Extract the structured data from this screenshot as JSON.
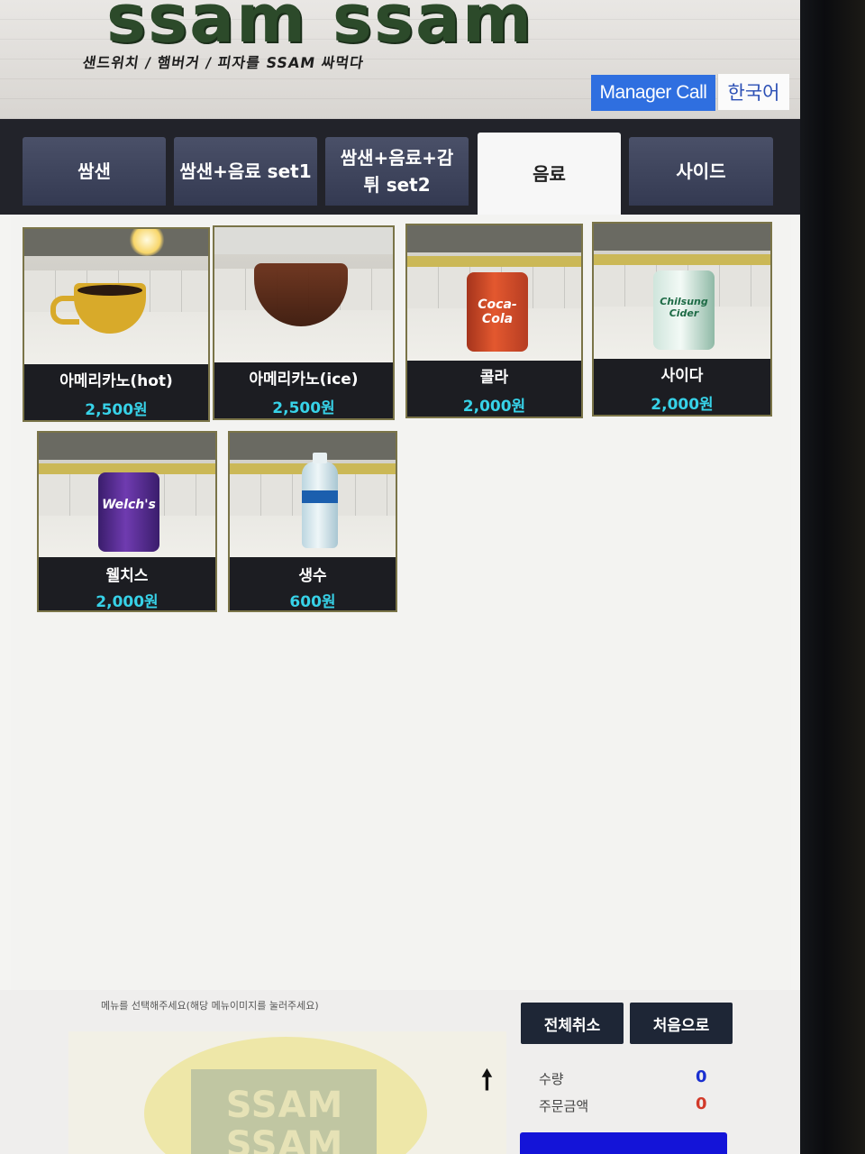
{
  "header": {
    "logo_text": "ssam ssam",
    "tagline": "샌드위치 / 햄버거 / 피자를 SSAM 싸먹다",
    "manager_call_label": "Manager Call",
    "language_label": "한국어"
  },
  "tabs": [
    {
      "label": "쌈샌"
    },
    {
      "label": "쌈샌+음료 set1"
    },
    {
      "label": "쌈샌+음료+감튀 set2"
    },
    {
      "label": "음료",
      "active": true
    },
    {
      "label": "사이드"
    }
  ],
  "menu_items": [
    {
      "name": "아메리카노(hot)",
      "price": "2,500원",
      "image": "hot-coffee-cup"
    },
    {
      "name": "아메리카노(ice)",
      "price": "2,500원",
      "image": "iced-coffee-glass"
    },
    {
      "name": "콜라",
      "price": "2,000원",
      "image": "coca-cola-can"
    },
    {
      "name": "사이다",
      "price": "2,000원",
      "image": "chilsung-cider-can"
    },
    {
      "name": "웰치스",
      "price": "2,000원",
      "image": "welchs-grape-can"
    },
    {
      "name": "생수",
      "price": "600원",
      "image": "water-bottle"
    }
  ],
  "can_labels": {
    "coke": "Coca-Cola",
    "cider": "Chilsung Cider",
    "grape": "Welch's"
  },
  "bottom": {
    "hint": "메뉴를 선택해주세요(해당 메뉴이미지를 눌러주세요)",
    "cart_logo_text": "SSAM SSAM",
    "cancel_all_label": "전체취소",
    "home_label": "처음으로",
    "quantity_label": "수량",
    "quantity_value": "0",
    "order_amount_label": "주문금액",
    "order_amount_value": "0"
  },
  "colors": {
    "manager_call_bg": "#2f6fe0",
    "price_text": "#37d2e8",
    "quantity_value": "#1a2fd0",
    "order_amount_value": "#d23a2a",
    "pay_button": "#1414d8"
  }
}
